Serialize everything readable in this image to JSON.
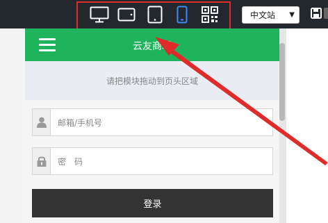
{
  "toolbar": {
    "devices": [
      {
        "icon": "desktop-icon",
        "active": false
      },
      {
        "icon": "tablet-landscape-icon",
        "active": false
      },
      {
        "icon": "tablet-portrait-icon",
        "active": false
      },
      {
        "icon": "phone-icon",
        "active": true
      },
      {
        "icon": "qr-code-icon",
        "active": false
      }
    ],
    "language_select": {
      "value": "中文站"
    },
    "save_icon": "save-icon"
  },
  "colors": {
    "toolbar_bg": "#23272e",
    "header_green": "#1fb35b",
    "active_device": "#3b8cf5",
    "annotation_red": "#e02b2b",
    "login_button_bg": "#333333"
  },
  "preview": {
    "header": {
      "title": "云友商城",
      "menu_icon": "hamburger-icon"
    },
    "drop_zone": {
      "text": "请把模块拖动到页头区域"
    },
    "login_form": {
      "account_placeholder": "邮箱/手机号",
      "password_placeholder": "密　码",
      "submit_label": "登录"
    }
  }
}
